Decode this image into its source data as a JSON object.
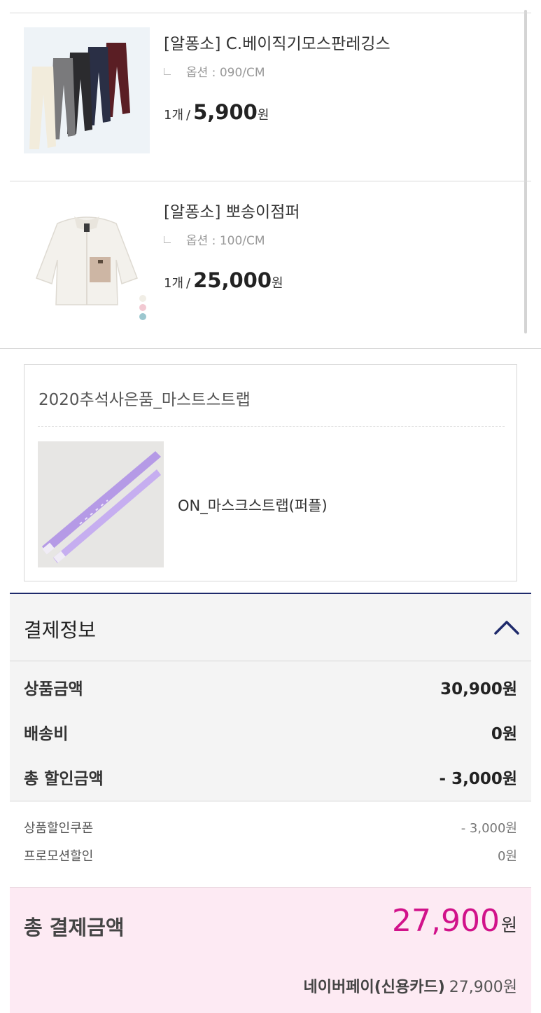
{
  "order_items": [
    {
      "name": "[알퐁소] C.베이직기모스판레깅스",
      "option": "옵션 : 090/CM",
      "qty": "1개",
      "price": "5,900",
      "unit": "원",
      "image": "leggings-photo"
    },
    {
      "name": "[알퐁소] 뽀송이점퍼",
      "option": "옵션 : 100/CM",
      "qty": "1개",
      "price": "25,000",
      "unit": "원",
      "image": "fleece-jacket-photo"
    }
  ],
  "gift": {
    "title": "2020추석사은품_마스트스트랩",
    "item_name": "ON_마스크스트랩(퍼플)",
    "image": "mask-strap-photo"
  },
  "payment": {
    "title": "결제정보",
    "toggle_icon": "chevron-up-icon",
    "accent_color": "#1e2a6b",
    "summary": [
      {
        "label": "상품금액",
        "value": "30,900원"
      },
      {
        "label": "배송비",
        "value": "0원"
      },
      {
        "label": "총 할인금액",
        "value": "- 3,000원"
      }
    ],
    "details": [
      {
        "label": "상품할인쿠폰",
        "value": "- 3,000원"
      },
      {
        "label": "프로모션할인",
        "value": "0원"
      }
    ],
    "total": {
      "label": "총 결제금액",
      "amount": "27,900",
      "unit": "원",
      "amount_color": "#d1128a",
      "background": "#fdeaf3"
    },
    "method": {
      "name": "네이버페이(신용카드)",
      "amount": "27,900원"
    }
  }
}
